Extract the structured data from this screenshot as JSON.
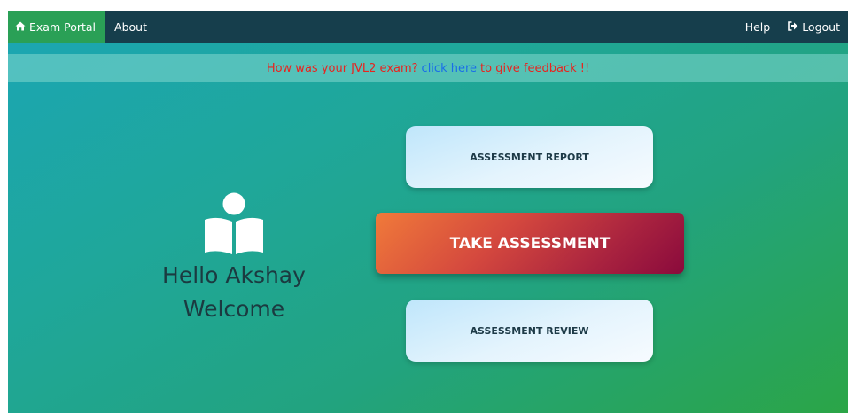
{
  "navbar": {
    "brand_label": "Exam Portal",
    "brand_icon": "home-icon",
    "about_label": "About",
    "help_label": "Help",
    "logout_label": "Logout",
    "logout_icon": "sign-out-icon",
    "background_color": "#163e4c",
    "brand_color": "#2aa056"
  },
  "banner": {
    "text_before": "How was your JVL2 exam?",
    "link_text": "click here",
    "text_after": "to give feedback !!",
    "text_color": "#e8231f",
    "link_color": "#1a6ee8"
  },
  "welcome": {
    "icon": "reader-icon",
    "greeting": "Hello Akshay",
    "message": "Welcome"
  },
  "actions": {
    "report_label": "ASSESSMENT REPORT",
    "take_label": "TAKE ASSESSMENT",
    "review_label": "ASSESSMENT REVIEW"
  }
}
